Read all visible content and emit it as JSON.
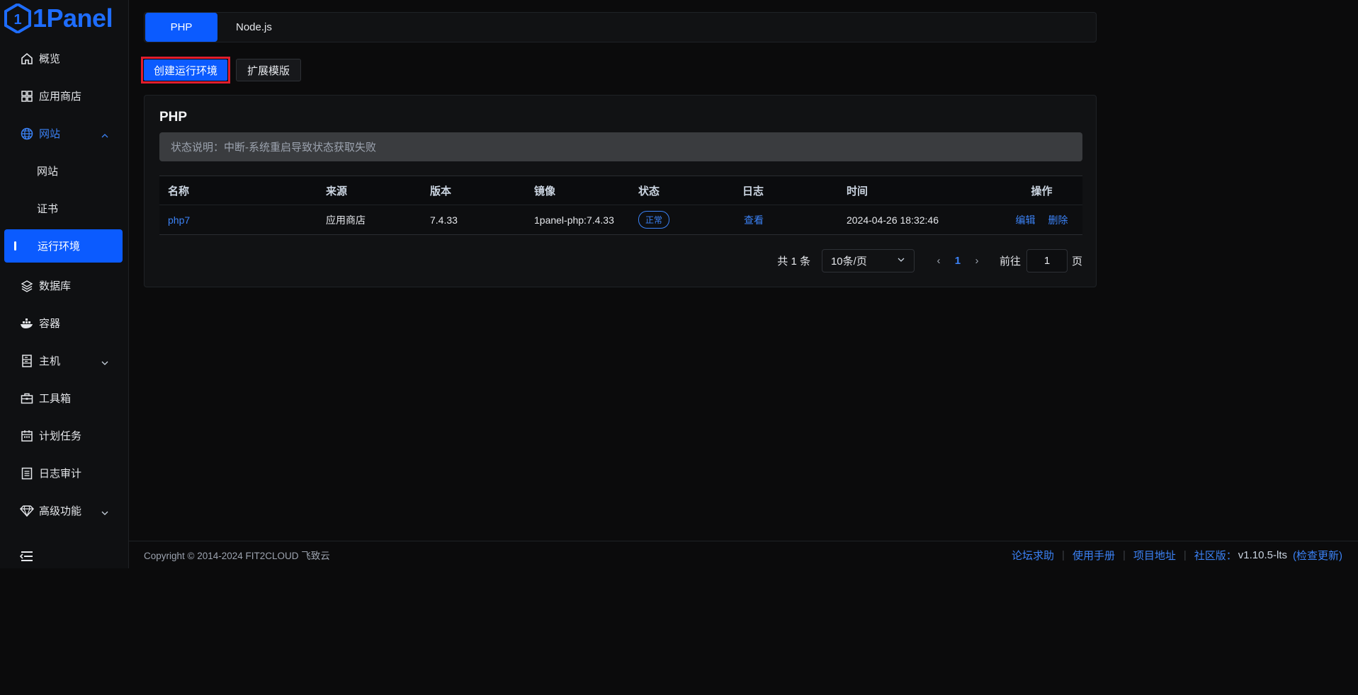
{
  "app": {
    "logo_text": "1Panel",
    "accent": "#0b5bff"
  },
  "sidebar": {
    "items": [
      {
        "label": "概览",
        "icon": "home-icon"
      },
      {
        "label": "应用商店",
        "icon": "grid-icon"
      },
      {
        "label": "网站",
        "icon": "globe-icon",
        "expanded": true
      },
      {
        "label": "网站",
        "sub": true
      },
      {
        "label": "证书",
        "sub": true
      },
      {
        "label": "运行环境",
        "sub": true,
        "active": true
      },
      {
        "label": "数据库",
        "icon": "layers-icon"
      },
      {
        "label": "容器",
        "icon": "docker-icon"
      },
      {
        "label": "主机",
        "icon": "server-icon",
        "has_children": true
      },
      {
        "label": "工具箱",
        "icon": "toolbox-icon"
      },
      {
        "label": "计划任务",
        "icon": "calendar-icon"
      },
      {
        "label": "日志审计",
        "icon": "log-icon"
      },
      {
        "label": "高级功能",
        "icon": "diamond-icon",
        "has_children": true
      }
    ]
  },
  "tabs": [
    {
      "label": "PHP",
      "active": true
    },
    {
      "label": "Node.js",
      "active": false
    }
  ],
  "actions": {
    "create_label": "创建运行环境",
    "template_label": "扩展模版"
  },
  "card": {
    "title": "PHP",
    "alert": "状态说明：中断-系统重启导致状态获取失败"
  },
  "table": {
    "headers": [
      "名称",
      "来源",
      "版本",
      "镜像",
      "状态",
      "日志",
      "时间",
      "操作"
    ],
    "rows": [
      {
        "name": "php7",
        "source": "应用商店",
        "version": "7.4.33",
        "image": "1panel-php:7.4.33",
        "status": "正常",
        "log": "查看",
        "time": "2024-04-26 18:32:46",
        "edit": "编辑",
        "delete": "删除"
      }
    ]
  },
  "pagination": {
    "total": "共 1 条",
    "page_size": "10条/页",
    "current_page": "1",
    "goto_label": "前往",
    "goto_value": "1",
    "page_unit": "页"
  },
  "footer": {
    "copyright": "Copyright © 2014-2024 FIT2CLOUD 飞致云",
    "forum": "论坛求助",
    "manual": "使用手册",
    "project": "项目地址",
    "edition": "社区版：",
    "version": "v1.10.5-lts",
    "check_update": "(检查更新)"
  }
}
